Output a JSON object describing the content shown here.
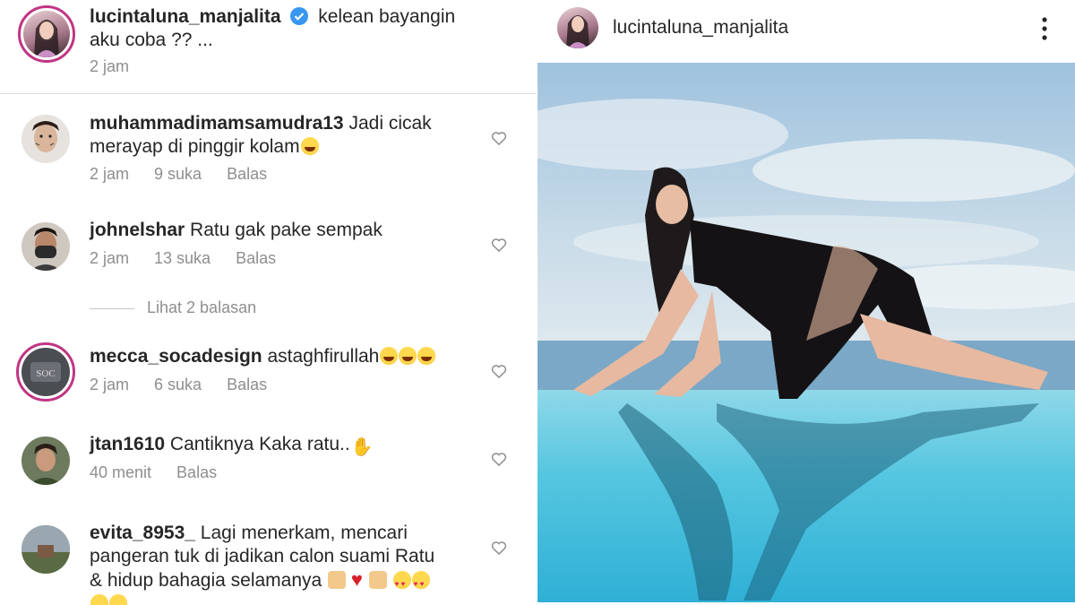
{
  "caption": {
    "username": "lucintaluna_manjalita",
    "text_line1": "kelean bayangin",
    "text_line2": "aku coba ?? ...",
    "time": "2 jam",
    "verified_icon": "verified-badge-icon"
  },
  "view_replies_label": "Lihat 2 balasan",
  "comments": [
    {
      "username": "muhammadimamsamudra13",
      "text_line1": "Jadi cicak",
      "text_line2": "merayap di pinggir kolam",
      "time": "2 jam",
      "likes": "9 suka",
      "reply": "Balas"
    },
    {
      "username": "johnelshar",
      "text_line1": "Ratu gak pake sempak",
      "time": "2 jam",
      "likes": "13 suka",
      "reply": "Balas"
    },
    {
      "username": "mecca_socadesign",
      "text_line1": "astaghfirullah",
      "time": "2 jam",
      "likes": "6 suka",
      "reply": "Balas"
    },
    {
      "username": "jtan1610",
      "text_line1": "Cantiknya Kaka ratu..",
      "time": "40 menit",
      "reply": "Balas"
    },
    {
      "username": "evita_8953_",
      "text_line1": "Lagi menerkam, mencari",
      "text_line2": "pangeran tuk di jadikan calon suami Ratu",
      "text_line3": "& hidup bahagia selamanya"
    }
  ],
  "post": {
    "username": "lucintaluna_manjalita",
    "more_icon": "more-vertical-icon"
  },
  "colors": {
    "text": "#262626",
    "muted": "#8e8e8e",
    "story_ring": "#c13584",
    "verified": "#3897f0"
  }
}
